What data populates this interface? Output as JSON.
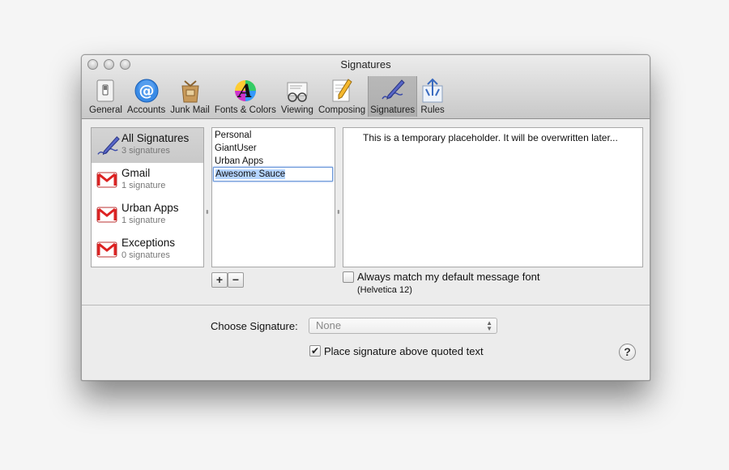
{
  "window": {
    "title": "Signatures"
  },
  "toolbar": {
    "items": [
      {
        "label": "General",
        "icon": "switch-icon"
      },
      {
        "label": "Accounts",
        "icon": "at-sign-icon"
      },
      {
        "label": "Junk Mail",
        "icon": "junk-bag-icon"
      },
      {
        "label": "Fonts & Colors",
        "icon": "font-palette-icon"
      },
      {
        "label": "Viewing",
        "icon": "glasses-icon"
      },
      {
        "label": "Composing",
        "icon": "pencil-paper-icon"
      },
      {
        "label": "Signatures",
        "icon": "signature-pen-icon",
        "selected": true
      },
      {
        "label": "Rules",
        "icon": "rules-icon"
      }
    ]
  },
  "accounts": [
    {
      "name": "All Signatures",
      "count": "3 signatures",
      "selected": true,
      "icon": "signature-pen-icon"
    },
    {
      "name": "Gmail",
      "count": "1 signature",
      "icon": "gmail-icon"
    },
    {
      "name": "Urban Apps",
      "count": "1 signature",
      "icon": "gmail-icon"
    },
    {
      "name": "Exceptions",
      "count": "0 signatures",
      "icon": "gmail-icon"
    }
  ],
  "signatures": {
    "items": [
      "Personal",
      "GiantUser",
      "Urban Apps"
    ],
    "editing": "Awesome Sauce"
  },
  "preview": {
    "text": "This is a temporary placeholder. It will be overwritten later..."
  },
  "font_option": {
    "label": "Always match my default message font",
    "checked": false,
    "font": "(Helvetica 12)"
  },
  "buttons": {
    "add": "+",
    "remove": "−"
  },
  "choose": {
    "label": "Choose Signature:",
    "value": "None"
  },
  "place_above": {
    "label": "Place signature above quoted text",
    "checked": true
  },
  "help": {
    "label": "?"
  }
}
